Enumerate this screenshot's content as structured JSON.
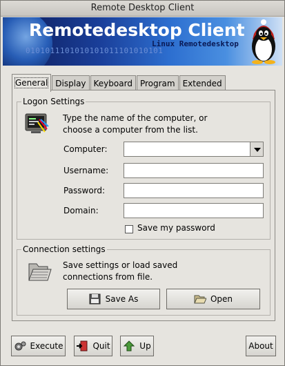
{
  "window": {
    "title": "Remote Desktop Client"
  },
  "banner": {
    "title": "Remotedesktop Client",
    "subtitle": "Linux Remotedesktop",
    "binary": "0101011101010101011101010101"
  },
  "tabs": [
    {
      "label": "General",
      "active": true
    },
    {
      "label": "Display",
      "active": false
    },
    {
      "label": "Keyboard",
      "active": false
    },
    {
      "label": "Program",
      "active": false
    },
    {
      "label": "Extended",
      "active": false
    }
  ],
  "logon": {
    "legend": "Logon Settings",
    "description_line1": "Type the name of the computer, or",
    "description_line2": "choose a computer from the list.",
    "computer_label": "Computer:",
    "computer_value": "",
    "username_label": "Username:",
    "username_value": "",
    "password_label": "Password:",
    "password_value": "",
    "domain_label": "Domain:",
    "domain_value": "",
    "save_password_label": "Save my password",
    "save_password_checked": false
  },
  "connection": {
    "legend": "Connection settings",
    "description_line1": "Save settings or load saved",
    "description_line2": "connections from file.",
    "save_as_label": "Save As",
    "open_label": "Open"
  },
  "footer": {
    "execute_label": "Execute",
    "quit_label": "Quit",
    "up_label": "Up",
    "about_label": "About"
  },
  "colors": {
    "banner_dark": "#0d1a55",
    "banner_light": "#4a8fe0",
    "window_bg": "#e6e4df"
  },
  "icons": {
    "computer": "monitor-icon",
    "folder": "folder-icon",
    "save": "floppy-icon",
    "open": "open-folder-icon",
    "execute": "gears-icon",
    "quit": "exit-door-icon",
    "up": "up-arrow-icon",
    "tux": "tux-penguin-icon"
  }
}
